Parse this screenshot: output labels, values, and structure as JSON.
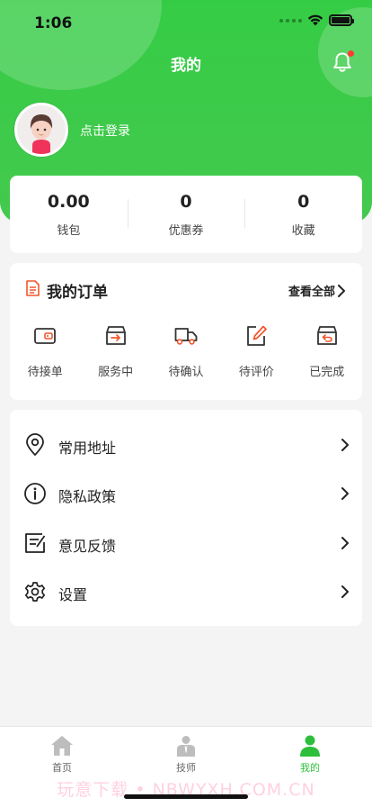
{
  "status_bar": {
    "time": "1:06"
  },
  "header": {
    "title": "我的"
  },
  "profile": {
    "login_text": "点击登录"
  },
  "stats": [
    {
      "value": "0.00",
      "label": "钱包"
    },
    {
      "value": "0",
      "label": "优惠券"
    },
    {
      "value": "0",
      "label": "收藏"
    }
  ],
  "orders": {
    "title": "我的订单",
    "view_all": "查看全部",
    "items": [
      {
        "label": "待接单",
        "icon": "wallet-icon"
      },
      {
        "label": "服务中",
        "icon": "box-arrow-icon"
      },
      {
        "label": "待确认",
        "icon": "truck-icon"
      },
      {
        "label": "待评价",
        "icon": "edit-icon"
      },
      {
        "label": "已完成",
        "icon": "box-return-icon"
      }
    ]
  },
  "menu": [
    {
      "label": "常用地址",
      "icon": "location-pin-icon"
    },
    {
      "label": "隐私政策",
      "icon": "info-icon"
    },
    {
      "label": "意见反馈",
      "icon": "feedback-icon"
    },
    {
      "label": "设置",
      "icon": "gear-icon"
    }
  ],
  "tabbar": [
    {
      "label": "首页",
      "icon": "home-icon",
      "active": false
    },
    {
      "label": "技师",
      "icon": "technician-icon",
      "active": false
    },
    {
      "label": "我的",
      "icon": "person-icon",
      "active": true
    }
  ],
  "colors": {
    "brand_green": "#35cc45",
    "accent_orange": "#f0562d",
    "badge_red": "#ff3b30"
  },
  "watermark": "玩意下载 • NBWYXH.COM.CN"
}
